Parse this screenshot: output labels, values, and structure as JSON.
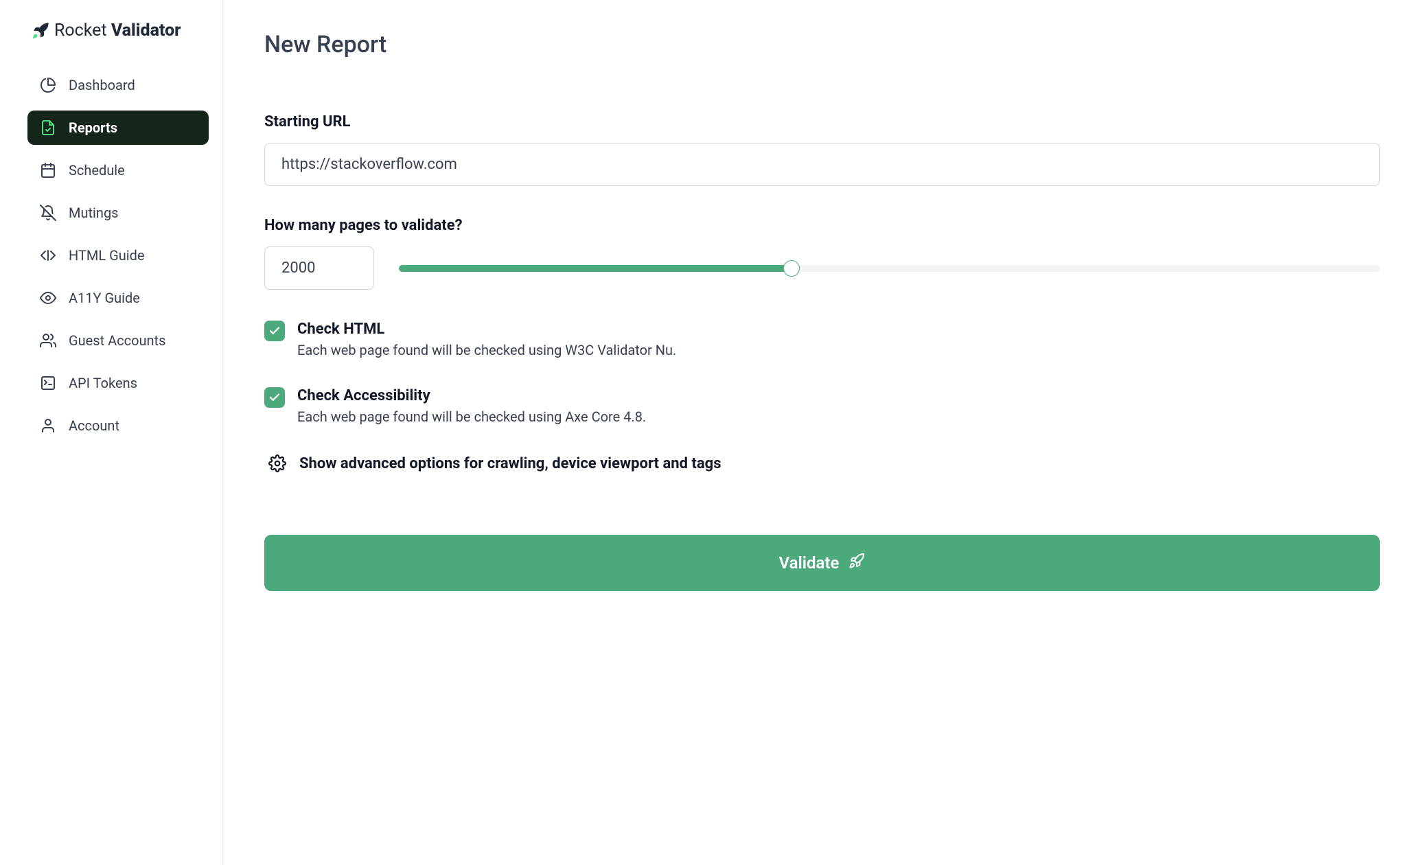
{
  "brand": {
    "name_light": "Rocket ",
    "name_bold": "Validator"
  },
  "sidebar": {
    "items": [
      {
        "id": "dashboard",
        "label": "Dashboard"
      },
      {
        "id": "reports",
        "label": "Reports"
      },
      {
        "id": "schedule",
        "label": "Schedule"
      },
      {
        "id": "mutings",
        "label": "Mutings"
      },
      {
        "id": "html-guide",
        "label": "HTML Guide"
      },
      {
        "id": "a11y-guide",
        "label": "A11Y Guide"
      },
      {
        "id": "guest-accounts",
        "label": "Guest Accounts"
      },
      {
        "id": "api-tokens",
        "label": "API Tokens"
      },
      {
        "id": "account",
        "label": "Account"
      }
    ]
  },
  "main": {
    "title": "New Report",
    "starting_url": {
      "label": "Starting URL",
      "value": "https://stackoverflow.com"
    },
    "pages": {
      "label": "How many pages to validate?",
      "value": "2000"
    },
    "check_html": {
      "label": "Check HTML",
      "description": "Each web page found will be checked using W3C Validator Nu."
    },
    "check_accessibility": {
      "label": "Check Accessibility",
      "description": "Each web page found will be checked using Axe Core 4.8."
    },
    "advanced": {
      "label": "Show advanced options for crawling, device viewport and tags"
    },
    "validate_button": "Validate"
  }
}
